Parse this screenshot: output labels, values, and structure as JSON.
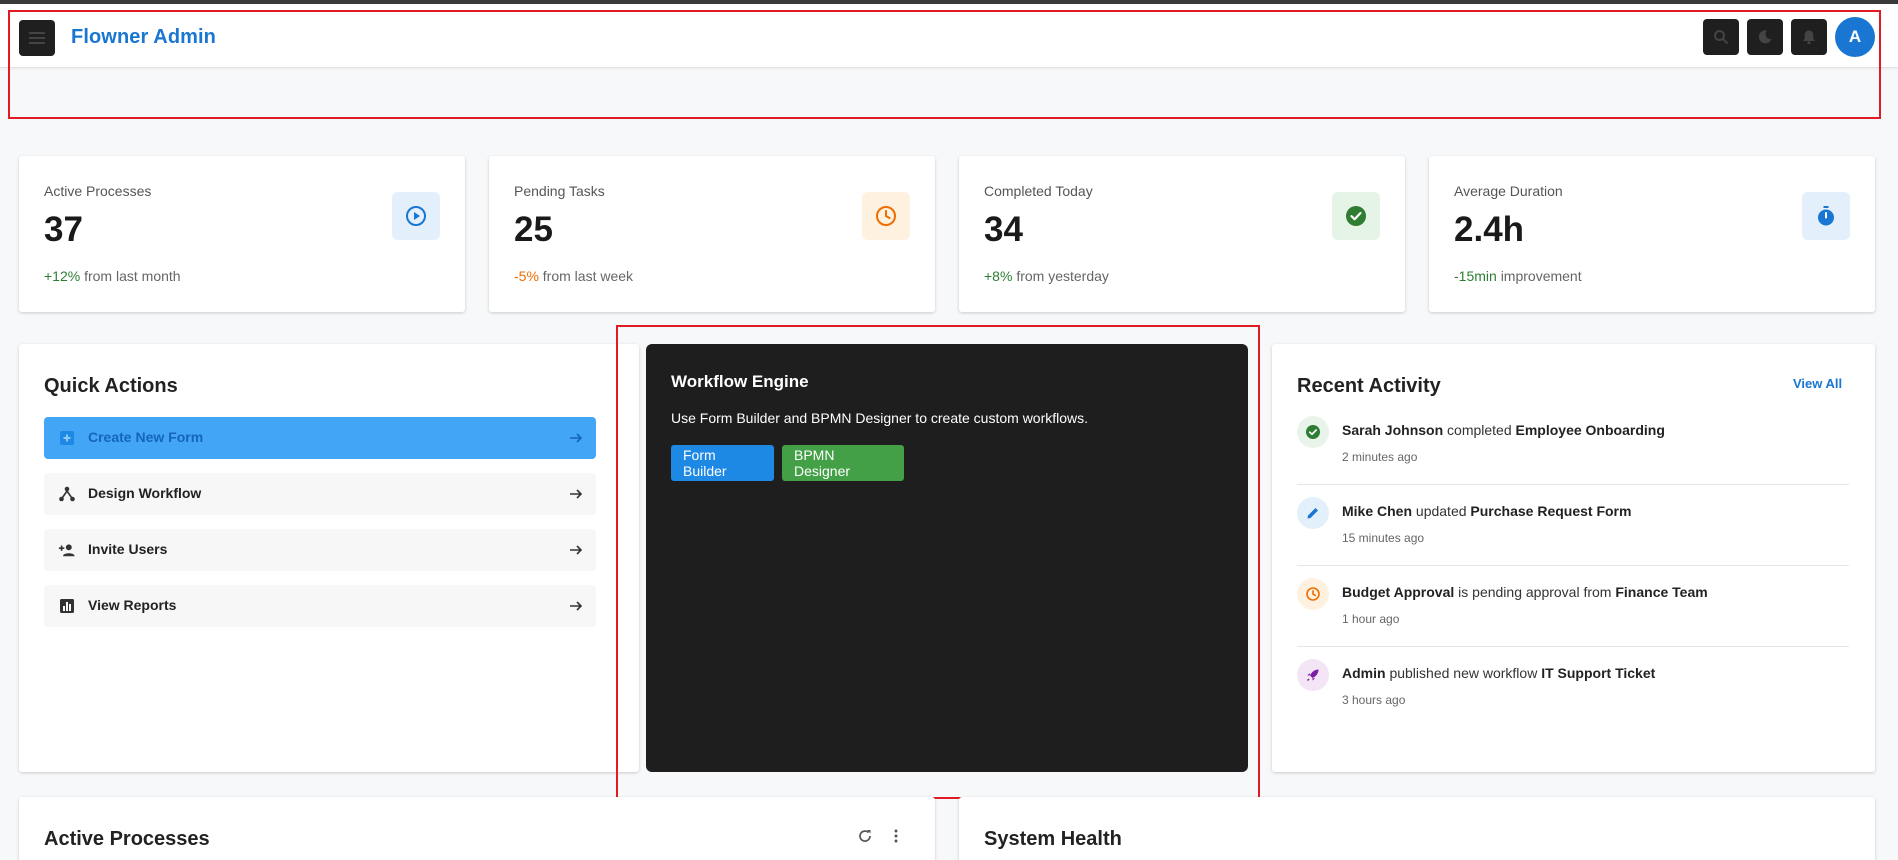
{
  "header": {
    "app_title": "Flowner Admin",
    "avatar_initial": "A",
    "icons": [
      "menu-icon",
      "search-icon",
      "moon-icon",
      "bell-icon"
    ]
  },
  "stats": [
    {
      "label": "Active Processes",
      "value": "37",
      "delta": "+12%",
      "delta_tone": "positive",
      "suffix": "from last month",
      "icon": "play-circle-icon",
      "badge_color": "#e3f0fb",
      "icon_color": "#1976d2"
    },
    {
      "label": "Pending Tasks",
      "value": "25",
      "delta": "-5%",
      "delta_tone": "negative",
      "suffix": "from last week",
      "icon": "clock-icon",
      "badge_color": "#fff1e0",
      "icon_color": "#ef6c00"
    },
    {
      "label": "Completed Today",
      "value": "34",
      "delta": "+8%",
      "delta_tone": "positive",
      "suffix": "from yesterday",
      "icon": "check-circle-icon",
      "badge_color": "#e6f3e7",
      "icon_color": "#2e7d32"
    },
    {
      "label": "Average Duration",
      "value": "2.4h",
      "delta": "-15min",
      "delta_tone": "positive",
      "suffix": "improvement",
      "icon": "timer-icon",
      "badge_color": "#e3f0fb",
      "icon_color": "#1976d2"
    }
  ],
  "quick_actions": {
    "title": "Quick Actions",
    "items": [
      {
        "label": "Create New Form",
        "icon": "add-box-icon",
        "primary": true
      },
      {
        "label": "Design Workflow",
        "icon": "workflow-icon",
        "primary": false
      },
      {
        "label": "Invite Users",
        "icon": "person-add-icon",
        "primary": false
      },
      {
        "label": "View Reports",
        "icon": "bar-chart-icon",
        "primary": false
      }
    ]
  },
  "workflow_engine": {
    "title": "Workflow Engine",
    "description": "Use Form Builder and BPMN Designer to create custom workflows.",
    "form_builder_label": "Form Builder",
    "bpmn_designer_label": "BPMN Designer",
    "form_builder_color": "#1e88e5",
    "bpmn_designer_color": "#43a047"
  },
  "recent_activity": {
    "title": "Recent Activity",
    "view_all": "View All",
    "items": [
      {
        "parts": [
          [
            "Sarah Johnson",
            true
          ],
          [
            " completed ",
            false
          ],
          [
            "Employee Onboarding",
            true
          ]
        ],
        "time": "2 minutes ago",
        "icon": "check-circle-icon",
        "tone": "#2e7d32",
        "bg": "#e8f4e9"
      },
      {
        "parts": [
          [
            "Mike Chen",
            true
          ],
          [
            " updated ",
            false
          ],
          [
            "Purchase Request Form",
            true
          ]
        ],
        "time": "15 minutes ago",
        "icon": "pencil-icon",
        "tone": "#1976d2",
        "bg": "#e3f0fb"
      },
      {
        "parts": [
          [
            "Budget Approval",
            true
          ],
          [
            " is pending approval from ",
            false
          ],
          [
            "Finance Team",
            true
          ]
        ],
        "time": "1 hour ago",
        "icon": "clock-icon",
        "tone": "#ef6c00",
        "bg": "#fff1e0"
      },
      {
        "parts": [
          [
            "Admin",
            true
          ],
          [
            " published new workflow ",
            false
          ],
          [
            "IT Support Ticket",
            true
          ]
        ],
        "time": "3 hours ago",
        "icon": "rocket-icon",
        "tone": "#7b1fa2",
        "bg": "#f3e5f5"
      }
    ]
  },
  "active_processes": {
    "title": "Active Processes",
    "icons": [
      "refresh-icon",
      "more-vert-icon"
    ]
  },
  "system_health": {
    "title": "System Health"
  },
  "highlight_color": "#e01b24"
}
